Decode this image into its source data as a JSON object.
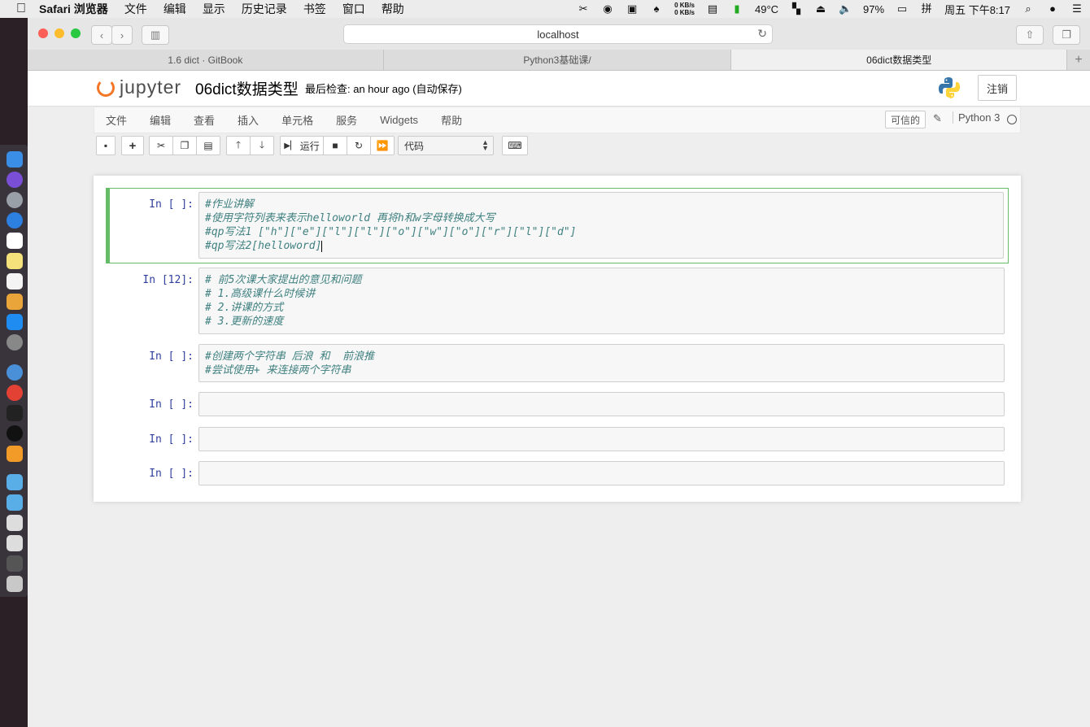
{
  "menubar": {
    "app": "Safari 浏览器",
    "items": [
      "文件",
      "编辑",
      "显示",
      "历史记录",
      "书签",
      "窗口",
      "帮助"
    ],
    "net_up": "0 KB/s",
    "net_down": "0 KB/s",
    "temperature": "49°C",
    "battery": "97%",
    "clock": "周五 下午8:17"
  },
  "browser": {
    "address": "localhost",
    "tabs": [
      {
        "label": "1.6 dict · GitBook"
      },
      {
        "label": "Python3基础课/"
      },
      {
        "label": "06dict数据类型"
      }
    ]
  },
  "jupyter": {
    "logo_text": "jupyter",
    "notebook_name": "06dict数据类型",
    "checkpoint": "最后检查: an hour ago  (自动保存)",
    "logout": "注销",
    "menu": [
      "文件",
      "编辑",
      "查看",
      "插入",
      "单元格",
      "服务",
      "Widgets",
      "帮助"
    ],
    "trusted": "可信的",
    "kernel": "Python 3",
    "toolbar": {
      "run_label": "运行",
      "cell_type": "代码"
    }
  },
  "cells": [
    {
      "prompt": "In [ ]:",
      "lines": [
        "#作业讲解",
        "#使用字符列表来表示helloworld 再将h和w字母转换成大写",
        "#qp写法1 [\"h\"][\"e\"][\"l\"][\"l\"][\"o\"][\"w\"][\"o\"][\"r\"][\"l\"][\"d\"]",
        "#qp写法2[helloword]"
      ]
    },
    {
      "prompt": "In [12]:",
      "lines": [
        "# 前5次课大家提出的意见和问题",
        "# 1.高级课什么时候讲",
        "# 2.讲课的方式",
        "# 3.更新的速度"
      ]
    },
    {
      "prompt": "In [ ]:",
      "lines": [
        "#创建两个字符串 后浪 和  前浪推",
        "#尝试使用+ 来连接两个字符串"
      ]
    },
    {
      "prompt": "In [ ]:",
      "lines": []
    },
    {
      "prompt": "In [ ]:",
      "lines": []
    },
    {
      "prompt": "In [ ]:",
      "lines": []
    }
  ],
  "colors": {
    "selected_border": "#66bb66",
    "prompt": "#303f9f",
    "comment": "#408080",
    "jupyter_orange": "#f37726"
  }
}
